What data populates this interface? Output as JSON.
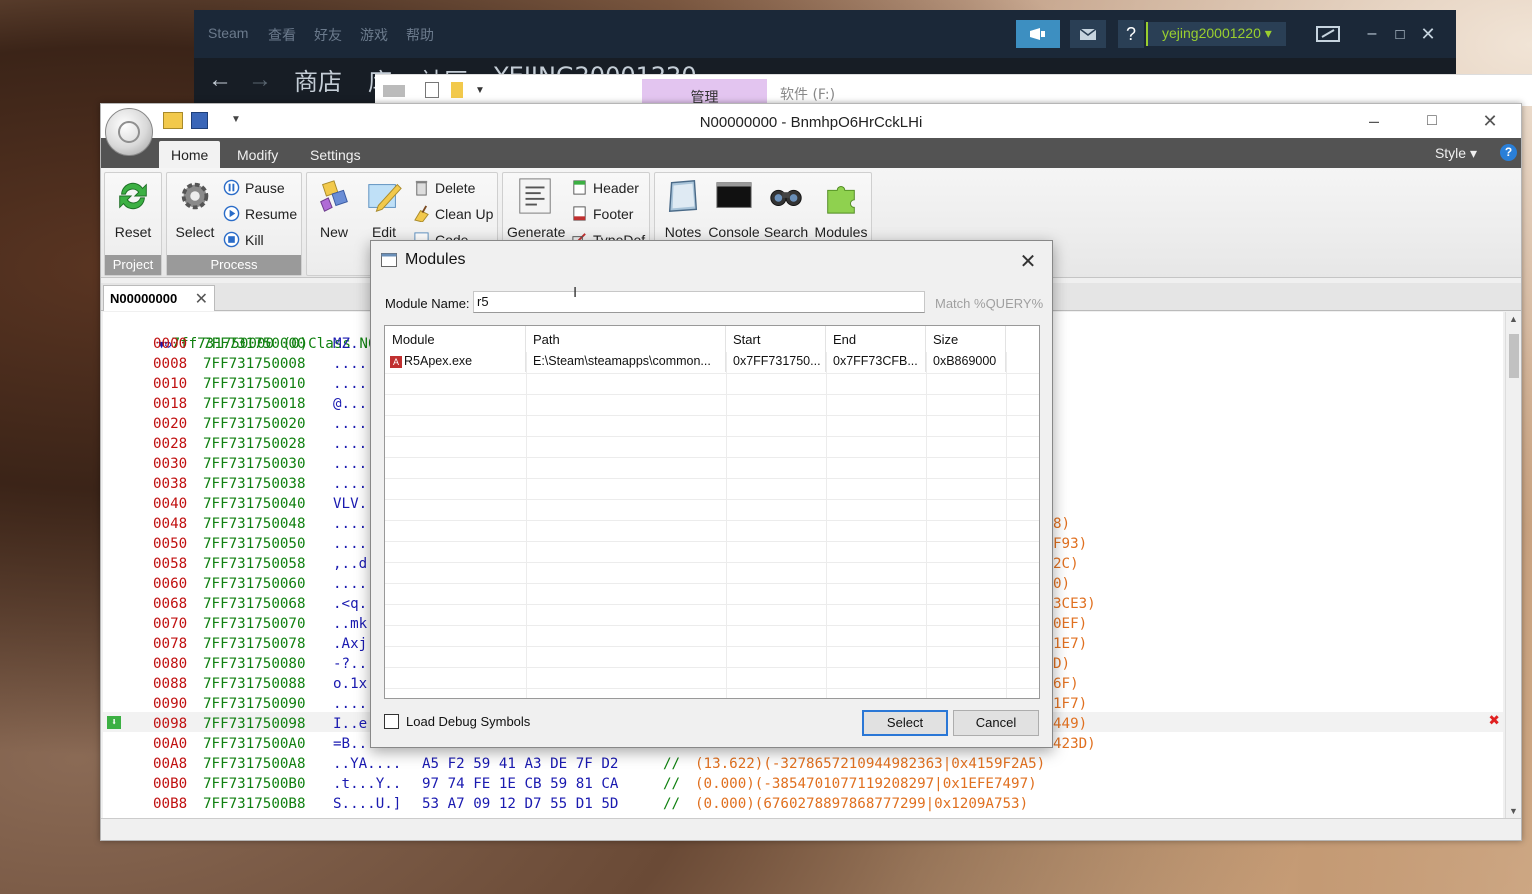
{
  "steam": {
    "menu": [
      "Steam",
      "查看",
      "好友",
      "游戏",
      "帮助"
    ],
    "nav": [
      "商店",
      "库",
      "社区",
      "YEJING20001220"
    ],
    "username": "yejing20001220"
  },
  "explorer": {
    "manage_tab": "管理",
    "path": "软件 (F:)"
  },
  "reclass": {
    "title": "N00000000 - BnmhpO6HrCckLHi",
    "tabs": [
      "Home",
      "Modify",
      "Settings"
    ],
    "style_label": "Style",
    "ribbon": {
      "reset": "Reset",
      "select": "Select",
      "pause": "Pause",
      "resume": "Resume",
      "kill": "Kill",
      "new": "New",
      "edit": "Edit",
      "delete": "Delete",
      "cleanup": "Clean Up",
      "code": "Code",
      "generate": "Generate",
      "header": "Header",
      "footer": "Footer",
      "typedef": "TypeDef",
      "notes": "Notes",
      "console": "Console",
      "search": "Search",
      "modules": "Modules",
      "group_project": "Project",
      "group_process": "Process"
    },
    "doc_tab": "N00000000",
    "class_header": "7ff731750000 (0)Class N0",
    "rows": [
      {
        "off": "0000",
        "addr": "7FF731750000",
        "txt": "MZ.",
        "hex": "",
        "right": ""
      },
      {
        "off": "0008",
        "addr": "7FF731750008",
        "txt": "....",
        "hex": "",
        "right": ""
      },
      {
        "off": "0010",
        "addr": "7FF731750010",
        "txt": "....",
        "hex": "",
        "right": ""
      },
      {
        "off": "0018",
        "addr": "7FF731750018",
        "txt": "@...",
        "hex": "",
        "right": ""
      },
      {
        "off": "0020",
        "addr": "7FF731750020",
        "txt": "....",
        "hex": "",
        "right": ""
      },
      {
        "off": "0028",
        "addr": "7FF731750028",
        "txt": "....",
        "hex": "",
        "right": ""
      },
      {
        "off": "0030",
        "addr": "7FF731750030",
        "txt": "....",
        "hex": "",
        "right": ""
      },
      {
        "off": "0038",
        "addr": "7FF731750038",
        "txt": "....",
        "hex": "",
        "right": ""
      },
      {
        "off": "0040",
        "addr": "7FF731750040",
        "txt": "VLV.",
        "hex": "",
        "right": ""
      },
      {
        "off": "0048",
        "addr": "7FF731750048",
        "txt": "....",
        "hex": "",
        "right": "8)"
      },
      {
        "off": "0050",
        "addr": "7FF731750050",
        "txt": "....",
        "hex": "",
        "right": "F93)"
      },
      {
        "off": "0058",
        "addr": "7FF731750058",
        "txt": ",..d",
        "hex": "",
        "right": "2C)"
      },
      {
        "off": "0060",
        "addr": "7FF731750060",
        "txt": "....",
        "hex": "",
        "right": "0)"
      },
      {
        "off": "0068",
        "addr": "7FF731750068",
        "txt": ".<q.",
        "hex": "",
        "right": "3CE3)"
      },
      {
        "off": "0070",
        "addr": "7FF731750070",
        "txt": "..mk",
        "hex": "",
        "right": "0EF)"
      },
      {
        "off": "0078",
        "addr": "7FF731750078",
        "txt": ".Axj",
        "hex": "",
        "right": "1E7)"
      },
      {
        "off": "0080",
        "addr": "7FF731750080",
        "txt": "-?..",
        "hex": "",
        "right": "D)"
      },
      {
        "off": "0088",
        "addr": "7FF731750088",
        "txt": "o.1x",
        "hex": "",
        "right": "6F)"
      },
      {
        "off": "0090",
        "addr": "7FF731750090",
        "txt": "....",
        "hex": "",
        "right": "1F7)"
      },
      {
        "off": "0098",
        "addr": "7FF731750098",
        "txt": "I..e",
        "hex": "",
        "right": "449)"
      },
      {
        "off": "00A0",
        "addr": "7FF7317500A0",
        "txt": "=B..",
        "hex": "",
        "right": "423D)"
      },
      {
        "off": "00A8",
        "addr": "7FF7317500A8",
        "txt": "..YA....",
        "hex": "A5 F2 59 41 A3 DE 7F D2",
        "right": "(13.622)(-3278657210944982363|0x4159F2A5)"
      },
      {
        "off": "00B0",
        "addr": "7FF7317500B0",
        "txt": ".t...Y..",
        "hex": "97 74 FE 1E CB 59 81 CA",
        "right": "(0.000)(-3854701077119208297|0x1EFE7497)"
      },
      {
        "off": "00B8",
        "addr": "7FF7317500B8",
        "txt": "S....U.]",
        "hex": "53 A7 09 12 D7 55 D1 5D",
        "right": "(0.000)(6760278897868777299|0x1209A753)"
      }
    ]
  },
  "modules_dialog": {
    "title": "Modules",
    "name_label": "Module Name:",
    "name_value": "r5",
    "match_label": "Match %QUERY%",
    "columns": [
      "Module",
      "Path",
      "Start",
      "End",
      "Size"
    ],
    "rows": [
      {
        "module": "R5Apex.exe",
        "path": "E:\\Steam\\steamapps\\common...",
        "start": "0x7FF731750...",
        "end": "0x7FF73CFB...",
        "size": "0xB869000"
      }
    ],
    "load_debug_label": "Load Debug Symbols",
    "select_label": "Select",
    "cancel_label": "Cancel"
  }
}
